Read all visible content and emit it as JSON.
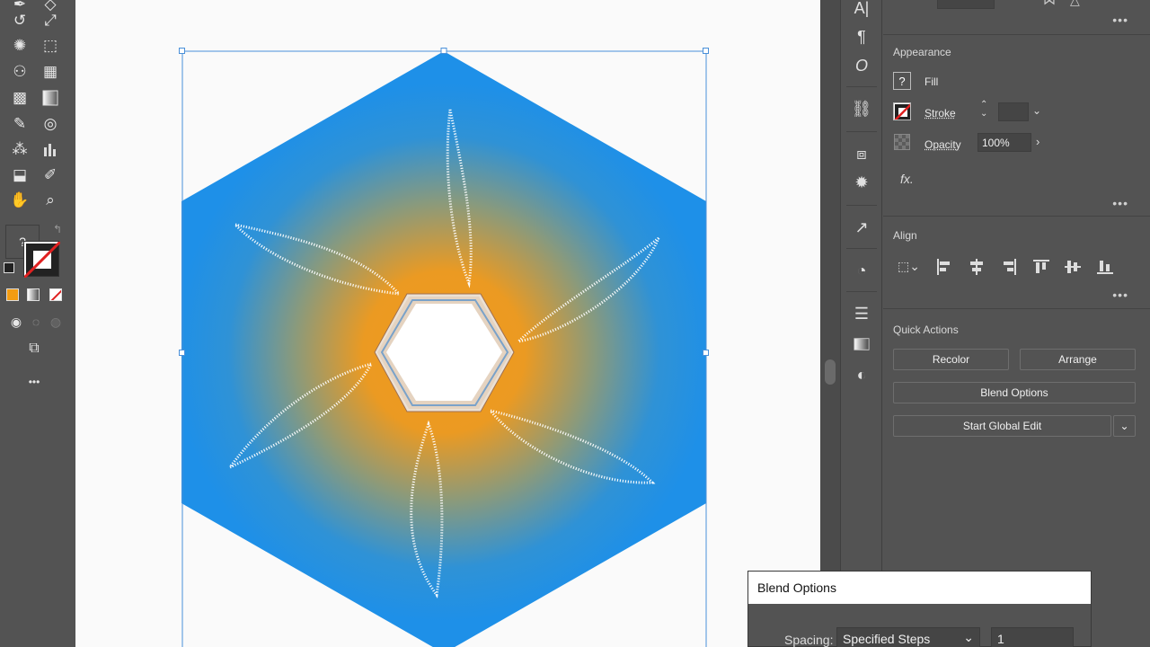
{
  "appearance": {
    "header": "Appearance",
    "fill_label": "Fill",
    "fill_swatch": "?",
    "stroke_label": "Stroke",
    "opacity_label": "Opacity",
    "opacity_value": "100%",
    "fx_label": "fx."
  },
  "align": {
    "header": "Align"
  },
  "quick_actions": {
    "header": "Quick Actions",
    "recolor": "Recolor",
    "arrange": "Arrange",
    "blend_options": "Blend Options",
    "start_global_edit": "Start Global Edit"
  },
  "toolbar": {
    "fill_swatch": "?",
    "more": "•••"
  },
  "panel_more": "•••",
  "dialog": {
    "title": "Blend Options",
    "spacing_label": "Spacing:",
    "spacing_value": "Specified Steps",
    "steps_value": "1"
  },
  "artwork": {
    "gradient_inner": "#f29a1c",
    "gradient_outer": "#1e90e8"
  }
}
